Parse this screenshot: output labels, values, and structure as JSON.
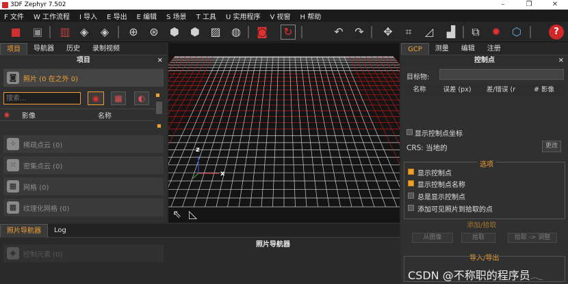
{
  "window": {
    "title": "3DF Zephyr 7.502"
  },
  "menu": [
    "F 文件",
    "W 工作流程",
    "I 导入",
    "E 导出",
    "E 编辑",
    "S 场景",
    "T 工具",
    "U 实用程序",
    "V 视窗",
    "H 帮助"
  ],
  "left": {
    "tabs": [
      "项目",
      "导航器",
      "历史",
      "录制视频"
    ],
    "title": "项目",
    "photos_label": "照片 (0 在之外 0)",
    "search_placeholder": "搜索...",
    "col_image": "影像",
    "col_name": "名称",
    "items": [
      "稀疏点云 (0)",
      "密集点云 (0)",
      "网格 (0)",
      "纹理化网格 (0)",
      "控制元素 (0)"
    ]
  },
  "viewport": {
    "axis_z": "z",
    "axis_x": "x"
  },
  "right": {
    "tabs": [
      "GCP",
      "测量",
      "编辑",
      "注册"
    ],
    "title": "控制点",
    "target_label": "目标物:",
    "columns": [
      "名称",
      "误差 (px)",
      "差/错误 (r",
      "# 影像"
    ],
    "show_coords": "显示控制点坐标",
    "crs_label": "CRS: 当地的",
    "change_btn": "更改",
    "options_title": "选项",
    "options": [
      {
        "label": "显示控制点",
        "checked": true
      },
      {
        "label": "显示控制点名称",
        "checked": true
      },
      {
        "label": "总是显示控制点",
        "checked": false
      },
      {
        "label": "添加可见照片到拾取的点",
        "checked": false
      }
    ],
    "partial_heading": "添加/拾取",
    "btn_a": "从图像",
    "btn_b": "拾取",
    "btn_c": "拾取 -> 调整",
    "import_export": "导入/导出"
  },
  "bottom": {
    "tabs": [
      "照片导航器",
      "Log"
    ],
    "title": "照片导航器"
  },
  "watermark": "CSDN @不称职的程序员𓂃",
  "colors": {
    "accent": "#f0a032",
    "grid_red": "#c01818",
    "grid_white": "#d0d0d0"
  }
}
